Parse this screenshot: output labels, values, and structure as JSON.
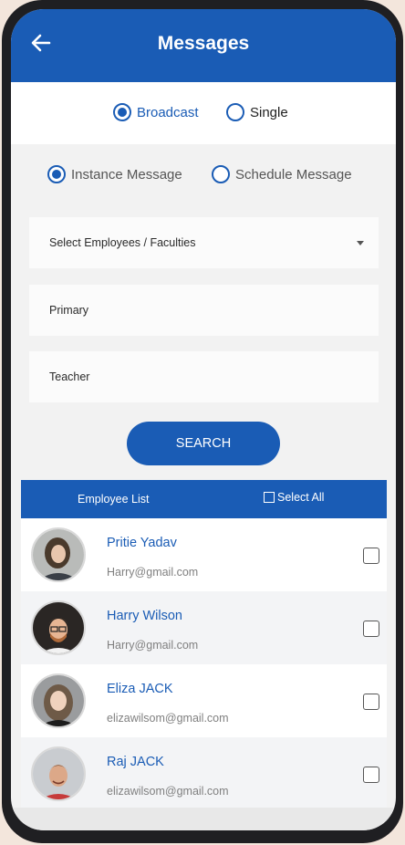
{
  "header": {
    "title": "Messages",
    "back_icon": "arrow-left-icon"
  },
  "mode": {
    "options": [
      "Broadcast",
      "Single"
    ],
    "selected": "Broadcast"
  },
  "timing": {
    "options": [
      "Instance Message",
      "Schedule Message"
    ],
    "selected": "Instance Message"
  },
  "filters": {
    "employees_select": "Select Employees / Faculties",
    "section": "Primary",
    "role": "Teacher"
  },
  "search_label": "SEARCH",
  "employee_list": {
    "title": "Employee List",
    "select_all_label": "Select All",
    "rows": [
      {
        "name": "Pritie Yadav",
        "email": "Harry@gmail.com",
        "checked": false
      },
      {
        "name": "Harry Wilson",
        "email": "Harry@gmail.com",
        "checked": false
      },
      {
        "name": "Eliza JACK",
        "email": "elizawilsom@gmail.com",
        "checked": false
      },
      {
        "name": "Raj JACK",
        "email": "elizawilsom@gmail.com",
        "checked": false
      }
    ]
  },
  "colors": {
    "brand": "#1a5cb5",
    "screen_bg": "#f2f2f2",
    "email_grey": "#808080"
  }
}
